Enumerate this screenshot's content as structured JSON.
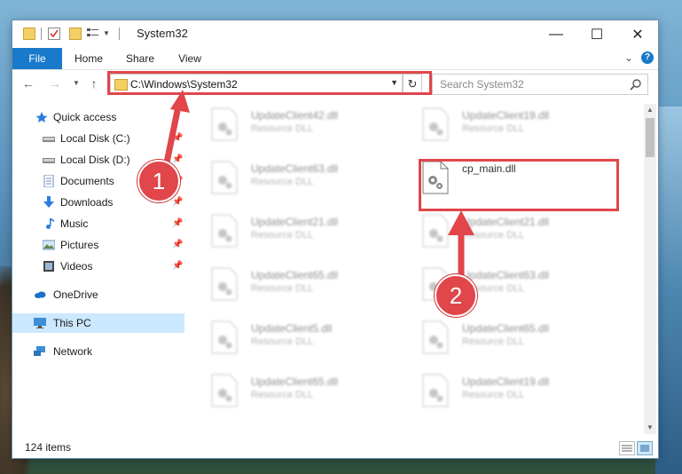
{
  "window": {
    "title": "System32"
  },
  "controls": {
    "minimize": "—",
    "maximize": "☐",
    "close": "✕"
  },
  "ribbon": {
    "tabs": [
      "File",
      "Home",
      "Share",
      "View"
    ],
    "help": "?"
  },
  "navigation": {
    "address": "C:\\Windows\\System32",
    "search_placeholder": "Search System32"
  },
  "sidebar": {
    "items": [
      {
        "label": "Quick access",
        "icon": "star-icon",
        "pinned": false
      },
      {
        "label": "Local Disk (C:)",
        "icon": "drive-icon",
        "pinned": true
      },
      {
        "label": "Local Disk (D:)",
        "icon": "drive-icon",
        "pinned": true
      },
      {
        "label": "Documents",
        "icon": "documents-icon",
        "pinned": true
      },
      {
        "label": "Downloads",
        "icon": "download-icon",
        "pinned": true
      },
      {
        "label": "Music",
        "icon": "music-icon",
        "pinned": true
      },
      {
        "label": "Pictures",
        "icon": "pictures-icon",
        "pinned": true
      },
      {
        "label": "Videos",
        "icon": "videos-icon",
        "pinned": true
      },
      {
        "label": "OneDrive",
        "icon": "cloud-icon",
        "pinned": false
      },
      {
        "label": "This PC",
        "icon": "computer-icon",
        "pinned": false,
        "selected": true
      },
      {
        "label": "Network",
        "icon": "network-icon",
        "pinned": false
      }
    ]
  },
  "files": {
    "left": [
      {
        "name": "UpdateClient42.dll",
        "type": "Resource DLL"
      },
      {
        "name": "UpdateClient63.dll",
        "type": "Resource DLL"
      },
      {
        "name": "UpdateClient21.dll",
        "type": "Resource DLL"
      },
      {
        "name": "UpdateClient65.dll",
        "type": "Resource DLL"
      },
      {
        "name": "UpdateClient5.dll",
        "type": "Resource DLL"
      },
      {
        "name": "UpdateClient65.dll",
        "type": "Resource DLL"
      }
    ],
    "right": [
      {
        "name": "UpdateClient19.dll",
        "type": "Resource DLL"
      },
      {
        "name": "cp_main.dll",
        "type": ""
      },
      {
        "name": "UpdateClient21.dll",
        "type": "Resource DLL"
      },
      {
        "name": "UpdateClient63.dll",
        "type": "Resource DLL"
      },
      {
        "name": "UpdateClient65.dll",
        "type": "Resource DLL"
      },
      {
        "name": "UpdateClient19.dll",
        "type": "Resource DLL"
      }
    ]
  },
  "status": {
    "item_count": "124 items"
  },
  "annotations": {
    "step1": "1",
    "step2": "2",
    "color": "#e0464a"
  }
}
